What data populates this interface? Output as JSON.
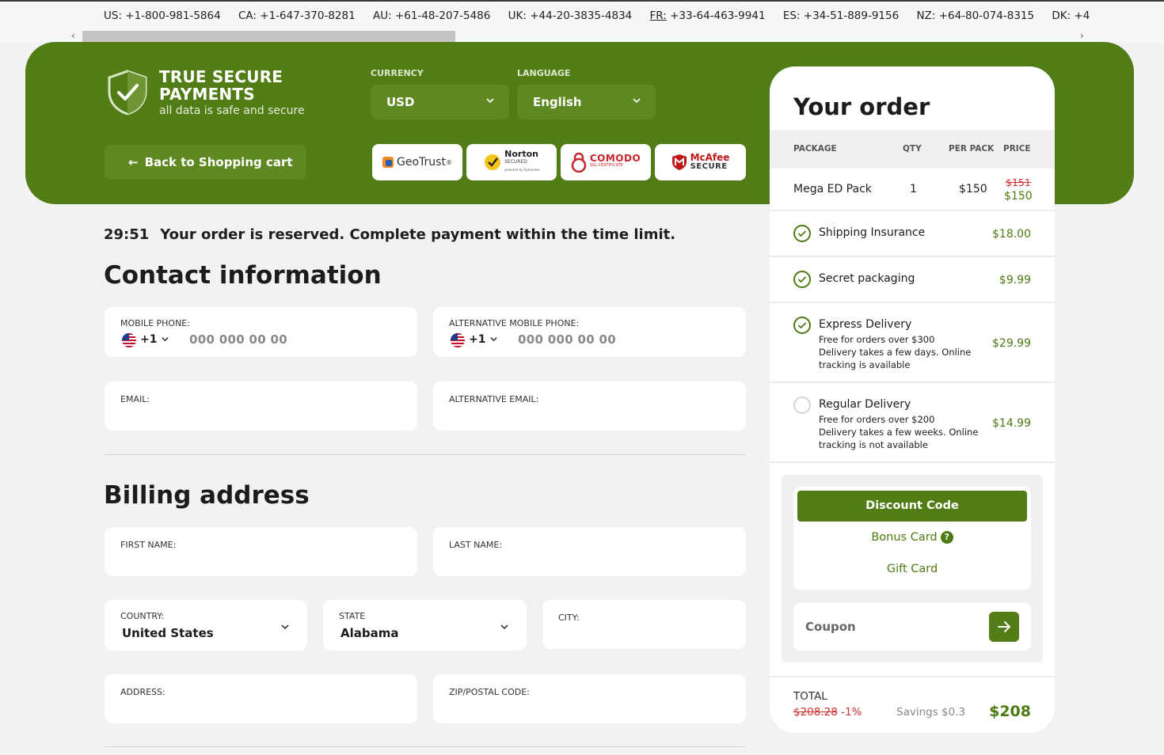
{
  "phones": [
    {
      "code": "US:",
      "number": "+1-800-981-5864"
    },
    {
      "code": "CA:",
      "number": "+1-647-370-8281"
    },
    {
      "code": "AU:",
      "number": "+61-48-207-5486"
    },
    {
      "code": "UK:",
      "number": "+44-20-3835-4834"
    },
    {
      "code": "FR:",
      "number": "+33-64-463-9941"
    },
    {
      "code": "ES:",
      "number": "+34-51-889-9156"
    },
    {
      "code": "NZ:",
      "number": "+64-80-074-8315"
    },
    {
      "code": "DK:",
      "number": "+4"
    }
  ],
  "header": {
    "logo_title_1": "TRUE SECURE",
    "logo_title_2": "PAYMENTS",
    "logo_sub": "all data is safe and secure",
    "currency_label": "CURRENCY",
    "currency_value": "USD",
    "language_label": "LANGUAGE",
    "language_value": "English",
    "back_label": "Back to Shopping cart",
    "badges": [
      "GeoTrust",
      "Norton",
      "COMODO",
      "McAfee SECURE"
    ],
    "badge_sub": {
      "geotrust_mark": "®",
      "norton_1": "Norton",
      "norton_2": "SECURED",
      "norton_3": "powered by Symantec",
      "comodo_sub": "SSL CERTIFICATE",
      "mcafee_1": "McAfee",
      "mcafee_2": "SECURE"
    }
  },
  "timer": {
    "time": "29:51",
    "message": "Your order is reserved. Complete payment within the time limit."
  },
  "contact": {
    "title": "Contact information",
    "mobile_label": "MOBILE PHONE:",
    "alt_mobile_label": "ALTERNATIVE MOBILE PHONE:",
    "dial_code": "+1",
    "phone_placeholder": "000 000 00 00",
    "email_label": "EMAIL:",
    "alt_email_label": "ALTERNATIVE EMAIL:"
  },
  "billing": {
    "title": "Billing address",
    "first_name_label": "FIRST NAME:",
    "last_name_label": "LAST NAME:",
    "country_label": "COUNTRY:",
    "country_value": "United States",
    "state_label": "STATE",
    "state_value": "Alabama",
    "city_label": "CITY:",
    "address_label": "ADDRESS:",
    "zip_label": "ZIP/POSTAL CODE:"
  },
  "order": {
    "title": "Your order",
    "columns": [
      "PACKAGE",
      "QTY",
      "PER PACK",
      "PRICE"
    ],
    "package": {
      "name": "Mega ED Pack",
      "qty": "1",
      "per_pack": "$150",
      "old_price": "$151",
      "price": "$150"
    },
    "options": [
      {
        "name": "Shipping Insurance",
        "price": "$18.00",
        "checked": true,
        "desc_1": "",
        "desc_2": ""
      },
      {
        "name": "Secret packaging",
        "price": "$9.99",
        "checked": true,
        "desc_1": "",
        "desc_2": ""
      },
      {
        "name": "Express Delivery",
        "price": "$29.99",
        "checked": true,
        "desc_1": "Free for orders over $300",
        "desc_2": "Delivery takes a few days. Online tracking is available"
      },
      {
        "name": "Regular Delivery",
        "price": "$14.99",
        "checked": false,
        "desc_1": "Free for orders over $200",
        "desc_2": "Delivery takes a few weeks. Online tracking is not available"
      }
    ],
    "discount_label": "Discount Code",
    "bonus_label": "Bonus Card",
    "bonus_help": "?",
    "gift_label": "Gift Card",
    "coupon_placeholder": "Coupon",
    "total_label": "TOTAL",
    "total_old": "$208.28",
    "total_discount": "-1%",
    "savings": "Savings $0.3",
    "total": "$208"
  },
  "colors": {
    "brand_green": "#527c15",
    "price_strike": "#d03030"
  }
}
